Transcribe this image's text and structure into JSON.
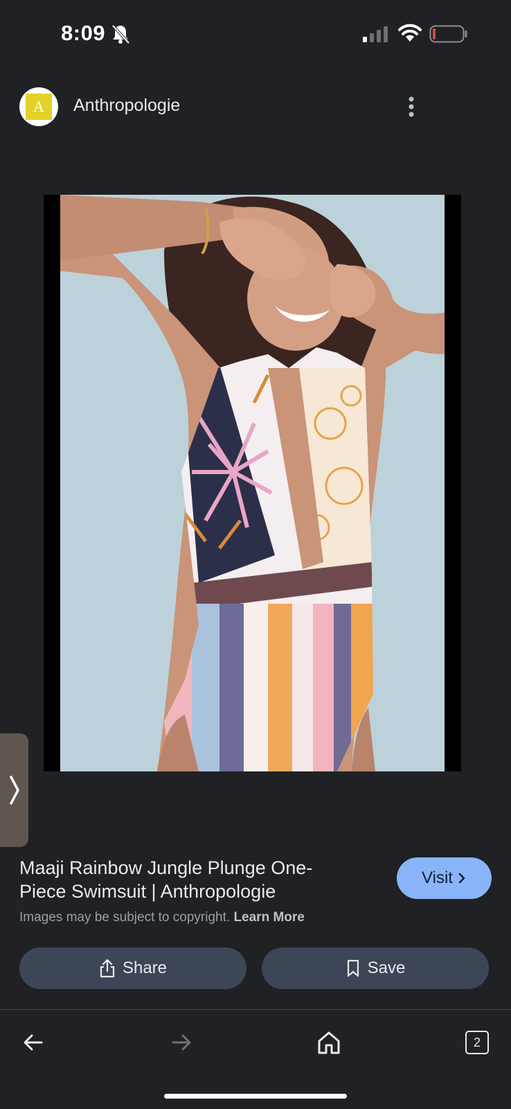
{
  "status_bar": {
    "time": "8:09",
    "icons": [
      "bell-off-icon",
      "signal-icon",
      "wifi-icon",
      "battery-low-icon"
    ]
  },
  "header": {
    "avatar_letter": "A",
    "source_name": "Anthropologie",
    "more_icon": "more-vertical-icon"
  },
  "image": {
    "alt": "Maaji Rainbow Jungle Plunge One-Piece Swimsuit"
  },
  "result": {
    "title": "Maaji Rainbow Jungle Plunge One-Piece Swimsuit | Anthropologie",
    "visit_label": "Visit",
    "copyright_text": "Images may be subject to copyright.",
    "learn_more_label": "Learn More"
  },
  "actions": {
    "share_label": "Share",
    "save_label": "Save"
  },
  "bottom_nav": {
    "tab_count": "2"
  },
  "colors": {
    "background": "#202124",
    "accent": "#8ab4f8",
    "button_bg": "#3c4656",
    "avatar_yellow": "#e3d329"
  }
}
